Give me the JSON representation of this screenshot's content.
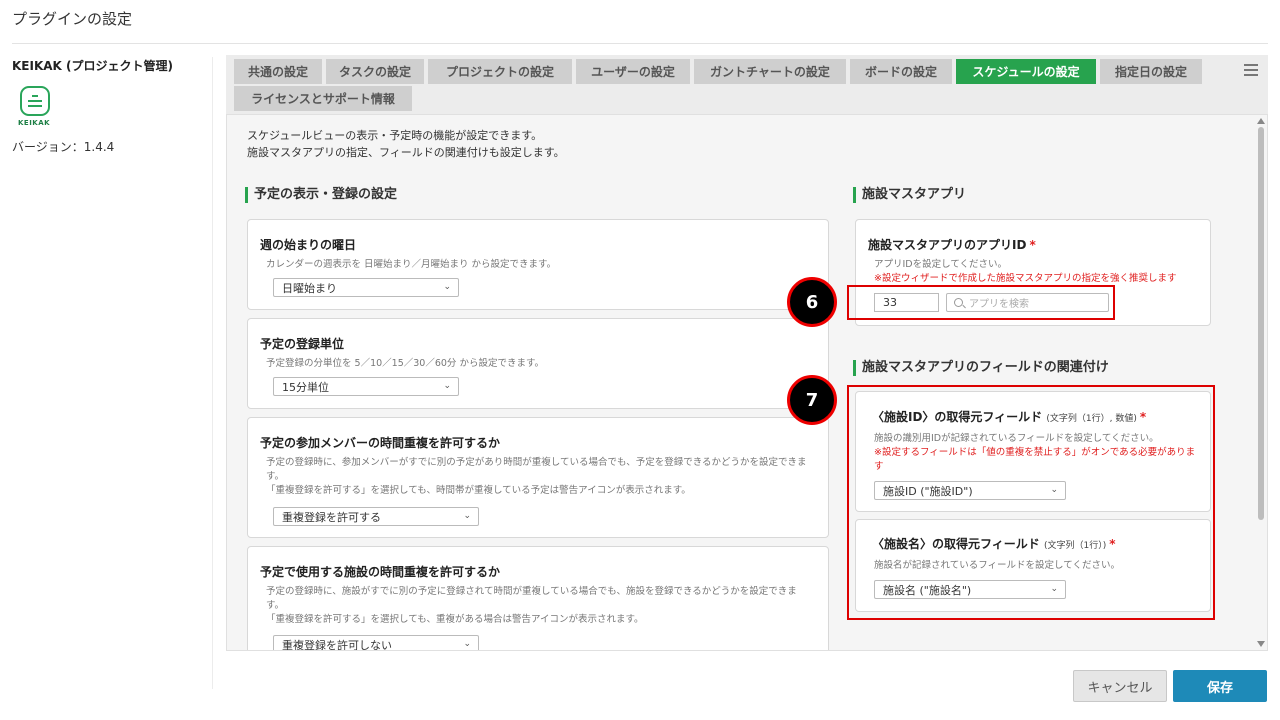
{
  "page": {
    "title": "プラグインの設定"
  },
  "plugin": {
    "name": "KEIKAK (プロジェクト管理)",
    "logo_text": "KEIKAK",
    "version": "バージョン：1.4.4"
  },
  "tabs": [
    {
      "label": "共通の設定"
    },
    {
      "label": "タスクの設定"
    },
    {
      "label": "プロジェクトの設定"
    },
    {
      "label": "ユーザーの設定"
    },
    {
      "label": "ガントチャートの設定"
    },
    {
      "label": "ボードの設定"
    },
    {
      "label": "スケジュールの設定",
      "active": true
    },
    {
      "label": "指定日の設定"
    },
    {
      "label": "ライセンスとサポート情報"
    }
  ],
  "content": {
    "desc1": "スケジュールビューの表示・予定時の機能が設定できます。",
    "desc2": "施設マスタアプリの指定、フィールドの関連付けも設定します。"
  },
  "left_section": {
    "title": "予定の表示・登録の設定",
    "week_start": {
      "title": "週の始まりの曜日",
      "desc": "カレンダーの週表示を 日曜始まり／月曜始まり から設定できます。",
      "value": "日曜始まり"
    },
    "unit": {
      "title": "予定の登録単位",
      "desc": "予定登録の分単位を 5／10／15／30／60分 から設定できます。",
      "value": "15分単位"
    },
    "member_overlap": {
      "title": "予定の参加メンバーの時間重複を許可するか",
      "desc1": "予定の登録時に、参加メンバーがすでに別の予定があり時間が重複している場合でも、予定を登録できるかどうかを設定できま",
      "desc2": "す。",
      "desc3": "「重複登録を許可する」を選択しても、時間帯が重複している予定は警告アイコンが表示されます。",
      "value": "重複登録を許可する"
    },
    "facility_overlap": {
      "title": "予定で使用する施設の時間重複を許可するか",
      "desc1": "予定の登録時に、施設がすでに別の予定に登録されて時間が重複している場合でも、施設を登録できるかどうかを設定できま",
      "desc2": "す。",
      "desc3": "「重複登録を許可する」を選択しても、重複がある場合は警告アイコンが表示されます。",
      "value": "重複登録を許可しない"
    }
  },
  "right_section": {
    "title": "施設マスタアプリ",
    "app_id": {
      "title": "施設マスタアプリのアプリID",
      "required": "*",
      "desc": "アプリIDを設定してください。",
      "warn": "※設定ウィザードで作成した施設マスタアプリの指定を強く推奨します",
      "value": "33",
      "search_placeholder": "アプリを検索"
    },
    "fields_title": "施設マスタアプリのフィールドの関連付け",
    "facility_id": {
      "title": "〈施設ID〉の取得元フィールド",
      "type_note": "(文字列（1行）, 数値)",
      "required": "*",
      "desc": "施設の識別用IDが記録されているフィールドを設定してください。",
      "warn1": "※設定するフィールドは「値の重複を禁止する」がオンである必要がありま",
      "warn2": "す",
      "value": "施設ID (\"施設ID\")"
    },
    "facility_name": {
      "title": "〈施設名〉の取得元フィールド",
      "type_note": "(文字列（1行）)",
      "required": "*",
      "desc": "施設名が記録されているフィールドを設定してください。",
      "value": "施設名 (\"施設名\")"
    }
  },
  "annotations": {
    "badge6": "6",
    "badge7": "7",
    "highlight_color": "#dd0000"
  },
  "footer": {
    "cancel_label": "キャンセル",
    "save_label": "保存"
  },
  "colors": {
    "accent": "#27a34e",
    "primary": "#1e8ab8",
    "warning": "#e02020"
  }
}
